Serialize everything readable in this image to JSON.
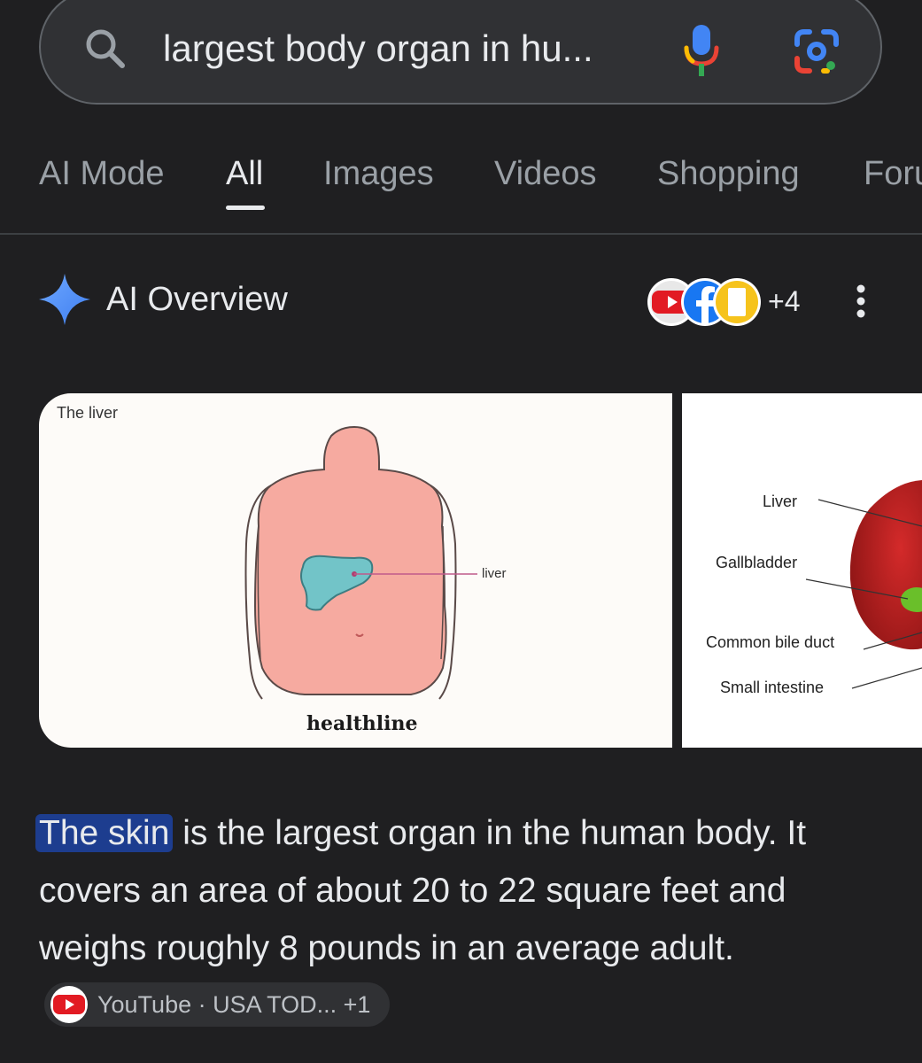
{
  "search": {
    "query": "largest body organ in hu..."
  },
  "tabs": [
    {
      "label": "AI Mode"
    },
    {
      "label": "All"
    },
    {
      "label": "Images"
    },
    {
      "label": "Videos"
    },
    {
      "label": "Shopping"
    },
    {
      "label": "Foru"
    }
  ],
  "overview": {
    "title": "AI Overview",
    "sources_more": "+4"
  },
  "images": {
    "card1": {
      "caption": "The liver",
      "organ_label": "liver",
      "brand": "healthline"
    },
    "card2": {
      "labels": [
        "Liver",
        "Gallbladder",
        "Common bile duct",
        "Small intestine"
      ]
    }
  },
  "answer": {
    "highlight": "The skin",
    "text": " is the largest organ in the human body. It covers an area of about 20 to 22 square feet and weighs roughly 8 pounds in an average adult.",
    "source_chip": "YouTube · USA TOD... +1"
  },
  "colors": {
    "background": "#1f1f21",
    "highlight": "#1d3d8f",
    "spark": "#4f8df5"
  }
}
